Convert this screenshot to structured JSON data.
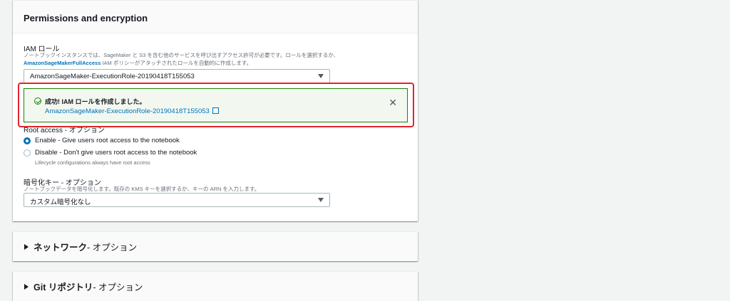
{
  "permissions": {
    "header": "Permissions and encryption",
    "iam_label": "IAM ロール",
    "iam_hint_line1": "ノートブックインスタンスでは、SageMaker と S3 を含む他のサービスを呼び出すアクセス許可が必要です。ロールを選択するか、",
    "iam_hint_link": "AmazonSageMakerFullAccess",
    "iam_hint_line2": " IAM ポリシーがアタッチされたロールを自動的に作成します。",
    "iam_selected": "AmazonSageMaker-ExecutionRole-20190418T155053",
    "flash": {
      "title": "成功! IAM ロールを作成しました。",
      "link": "AmazonSageMaker-ExecutionRole-20190418T155053",
      "close": "✕"
    },
    "root_label": "Root access - オプション",
    "root_options": [
      {
        "label": "Enable - Give users root access to the notebook",
        "checked": true
      },
      {
        "label": "Disable - Don't give users root access to the notebook",
        "checked": false
      }
    ],
    "root_sub": "Lifecycle configurations always have root access",
    "enc_label": "暗号化キー - オプション",
    "enc_hint": "ノートブックデータを暗号化します。既存の KMS キーを選択するか、キーの ARN を入力します。",
    "enc_selected": "カスタム暗号化なし"
  },
  "network": {
    "title": "ネットワーク",
    "optional": " - オプション"
  },
  "git": {
    "title": "Git リポジトリ",
    "optional": " - オプション"
  },
  "colors": {
    "accent": "#0073bb",
    "success": "#1d8102",
    "highlight": "#e3242b"
  }
}
